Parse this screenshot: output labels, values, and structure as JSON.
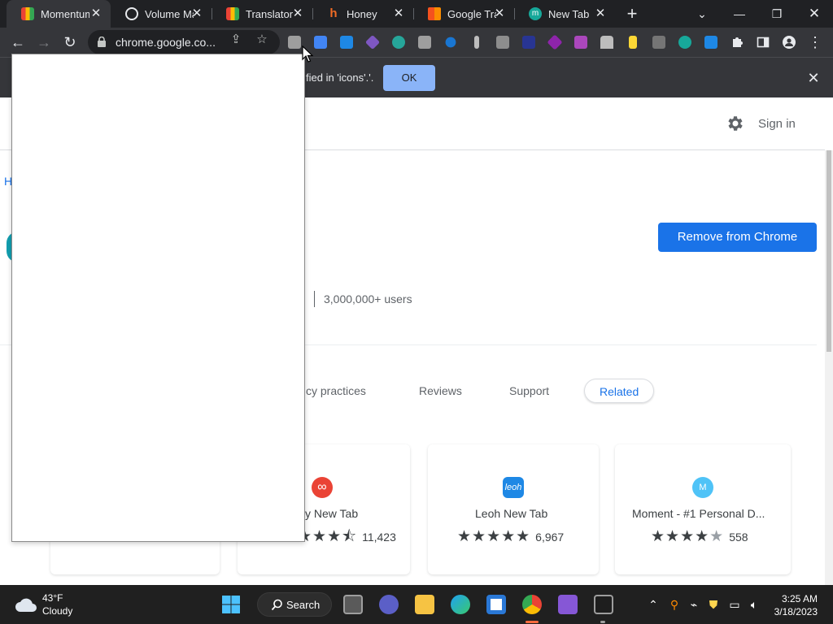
{
  "tabs": [
    {
      "title": "Momentum",
      "favicon": "chrome-web-store-icon",
      "active": true
    },
    {
      "title": "Volume Ma",
      "favicon": "circle-outline-icon",
      "active": false
    },
    {
      "title": "Translator",
      "favicon": "chrome-web-store-icon",
      "active": false
    },
    {
      "title": "Honey",
      "favicon": "honey-h-icon",
      "active": false
    },
    {
      "title": "Google Tra",
      "favicon": "google-translate-icon",
      "active": false
    },
    {
      "title": "New Tab",
      "favicon": "momentum-m-icon",
      "active": false
    }
  ],
  "toolbar": {
    "url": "chrome.google.co...",
    "extension_count": 17
  },
  "infobar": {
    "message": "fied in 'icons'.'.",
    "ok_label": "OK"
  },
  "header": {
    "signin": "Sign in"
  },
  "breadcrumb": "H",
  "detail": {
    "remove_button": "Remove from Chrome",
    "users": "3,000,000+ users"
  },
  "page_tabs": [
    {
      "label": "cy practices",
      "selected": false
    },
    {
      "label": "Reviews",
      "selected": false
    },
    {
      "label": "Support",
      "selected": false
    },
    {
      "label": "Related",
      "selected": true
    }
  ],
  "related": [
    {
      "title": "ity New Tab",
      "rating": 4.5,
      "count": "11,423",
      "icon": "infinity-icon",
      "color": "#ea4335"
    },
    {
      "title": "Leoh New Tab",
      "rating": 5,
      "count": "6,967",
      "icon": "leoh-icon",
      "icon_text": "leoh",
      "color": "#1e88e5"
    },
    {
      "title": "Moment - #1 Personal D...",
      "rating": 4,
      "count": "558",
      "icon": "moment-m-icon",
      "icon_text": "M",
      "color": "#4fc3f7"
    }
  ],
  "taskbar": {
    "temperature": "43°F",
    "condition": "Cloudy",
    "search_label": "Search",
    "time": "3:25 AM",
    "date": "3/18/2023"
  },
  "colors": {
    "accent": "#1a73e8",
    "infobar_ok": "#8ab4f8",
    "chrome_dark": "#202124",
    "toolbar": "#35363a"
  }
}
